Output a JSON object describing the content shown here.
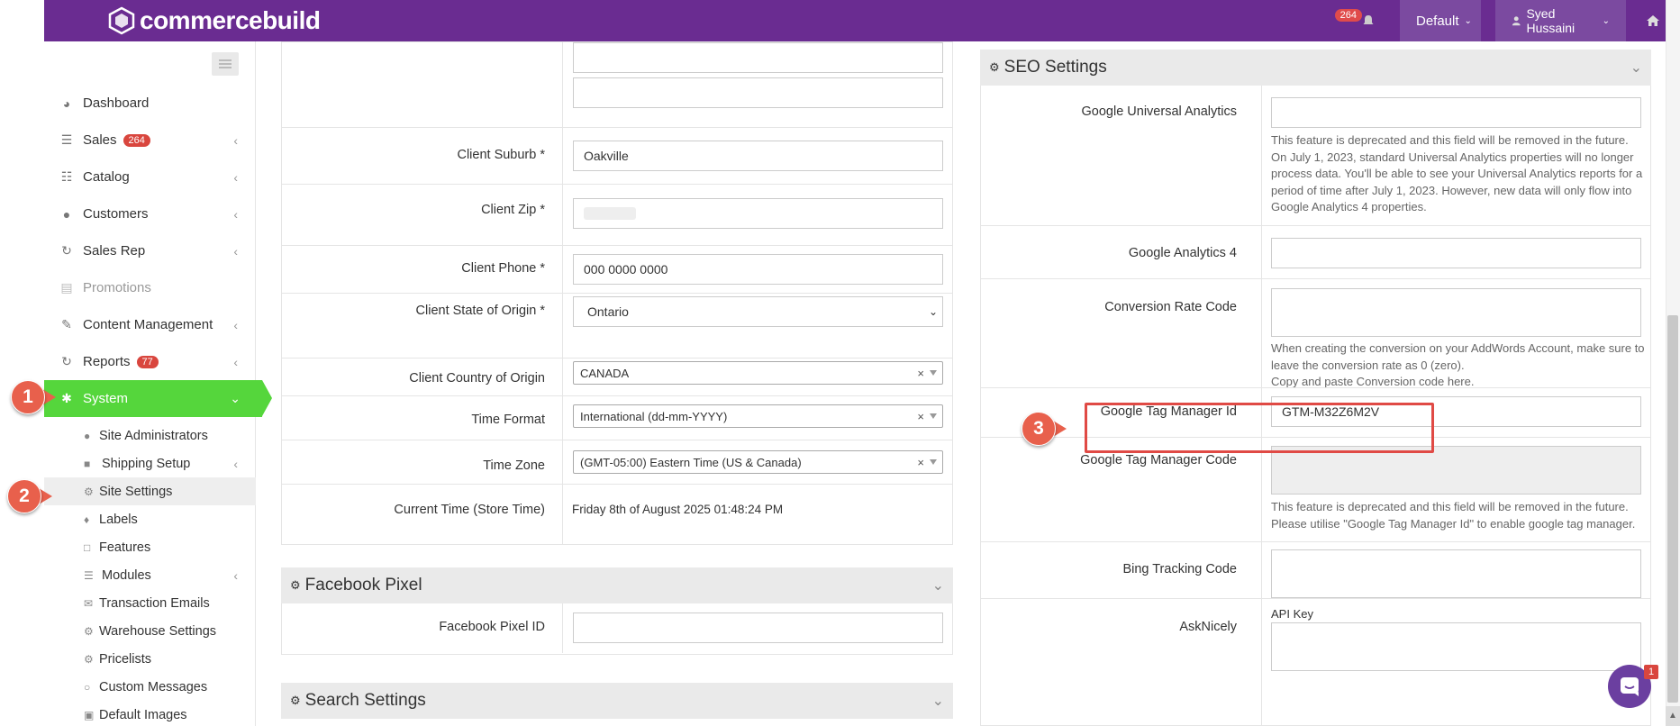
{
  "topbar": {
    "logo_text": "commercebuild",
    "notifications_count": "264",
    "store_select": "Default",
    "user_name": "Syed Hussaini"
  },
  "sidebar": {
    "items": [
      {
        "label": "Dashboard",
        "icon": "dashboard-icon"
      },
      {
        "label": "Sales",
        "badge": "264",
        "icon": "sales-icon"
      },
      {
        "label": "Catalog",
        "icon": "catalog-icon"
      },
      {
        "label": "Customers",
        "icon": "user-icon"
      },
      {
        "label": "Sales Rep",
        "icon": "refresh-icon"
      },
      {
        "label": "Promotions",
        "icon": "chart-icon"
      },
      {
        "label": "Content Management",
        "icon": "edit-icon"
      },
      {
        "label": "Reports",
        "badge": "77",
        "icon": "refresh-icon"
      },
      {
        "label": "System",
        "icon": "cogs-icon"
      }
    ],
    "system_sub": [
      {
        "label": "Site Administrators"
      },
      {
        "label": "Shipping Setup"
      },
      {
        "label": "Site Settings"
      },
      {
        "label": "Labels"
      },
      {
        "label": "Features"
      },
      {
        "label": "Modules"
      },
      {
        "label": "Transaction Emails"
      },
      {
        "label": "Warehouse Settings"
      },
      {
        "label": "Pricelists"
      },
      {
        "label": "Custom Messages"
      },
      {
        "label": "Default Images"
      }
    ]
  },
  "client": {
    "suburb_label": "Client Suburb *",
    "suburb_value": "Oakville",
    "zip_label": "Client Zip *",
    "phone_label": "Client Phone *",
    "phone_value": "000 0000 0000",
    "state_label": "Client State of Origin *",
    "state_value": "Ontario",
    "country_label": "Client Country of Origin",
    "country_value": "CANADA",
    "timeformat_label": "Time Format",
    "timeformat_value": "International (dd-mm-YYYY)",
    "timezone_label": "Time Zone",
    "timezone_value": "(GMT-05:00) Eastern Time (US & Canada)",
    "currenttime_label": "Current Time (Store Time)",
    "currenttime_value": "Friday 8th of August 2025 01:48:24 PM"
  },
  "facebook": {
    "title": "Facebook Pixel",
    "pixel_label": "Facebook Pixel ID"
  },
  "search": {
    "title": "Search Settings"
  },
  "seo": {
    "title": "SEO Settings",
    "ua_label": "Google Universal Analytics",
    "ua_help": "This feature is deprecated and this field will be removed in the future. On July 1, 2023, standard Universal Analytics properties will no longer process data. You'll be able to see your Universal Analytics reports for a period of time after July 1, 2023. However, new data will only flow into Google Analytics 4 properties.",
    "ga4_label": "Google Analytics 4",
    "conv_label": "Conversion Rate Code",
    "conv_help1": "When creating the conversion on your AddWords Account, make sure to leave the conversion rate as 0 (zero).",
    "conv_help2": "Copy and paste Conversion code here.",
    "gtm_id_label": "Google Tag Manager Id",
    "gtm_id_value": "GTM-M32Z6M2V",
    "gtm_code_label": "Google Tag Manager Code",
    "gtm_code_help": "This feature is deprecated and this field will be removed in the future. Please utilise \"Google Tag Manager Id\" to enable google tag manager.",
    "bing_label": "Bing Tracking Code",
    "asknicely_label": "AskNicely",
    "api_key_label": "API Key"
  },
  "markers": {
    "m1": "1",
    "m2": "2",
    "m3": "3"
  },
  "chat": {
    "badge": "1"
  },
  "colors": {
    "topbar": "#6a2c91",
    "system_active": "#55d63c",
    "marker": "#e8604c",
    "highlight": "#e04a45"
  }
}
